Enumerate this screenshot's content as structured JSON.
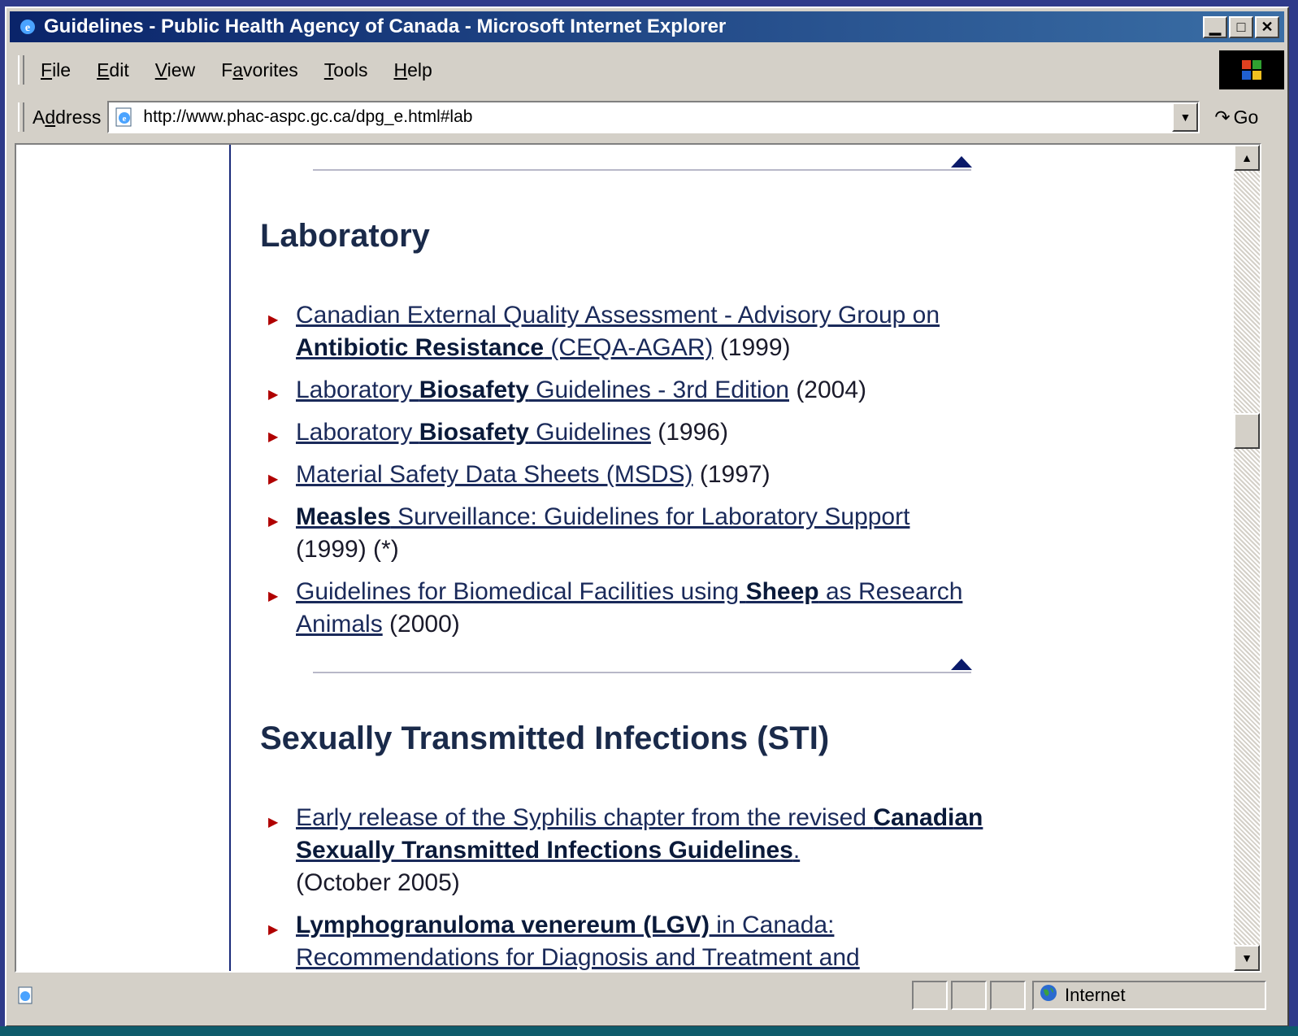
{
  "window": {
    "title": "Guidelines - Public Health Agency of Canada - Microsoft Internet Explorer",
    "min_glyph": "▁",
    "max_glyph": "□",
    "close_glyph": "✕"
  },
  "menu": {
    "items": [
      {
        "accel": "F",
        "rest": "ile"
      },
      {
        "accel": "E",
        "rest": "dit"
      },
      {
        "accel": "V",
        "rest": "iew"
      },
      {
        "pre": "F",
        "accel": "a",
        "rest": "vorites"
      },
      {
        "accel": "T",
        "rest": "ools"
      },
      {
        "accel": "H",
        "rest": "elp"
      }
    ]
  },
  "address": {
    "label_pre": "A",
    "label_accel": "d",
    "label_rest": "dress",
    "url": "http://www.phac-aspc.gc.ca/dpg_e.html#lab",
    "go_label": "Go"
  },
  "sections": {
    "laboratory": {
      "heading": "Laboratory",
      "items": [
        {
          "parts": [
            "Canadian External Quality Assessment - Advisory Group on ",
            "Antibiotic Resistance",
            " (CEQA-AGAR)"
          ],
          "suffix": " (1999)"
        },
        {
          "parts": [
            "Laboratory ",
            "Biosafety",
            " Guidelines - 3rd Edition"
          ],
          "suffix": " (2004)"
        },
        {
          "parts": [
            "Laboratory ",
            "Biosafety",
            " Guidelines"
          ],
          "suffix": " (1996)"
        },
        {
          "parts": [
            "Material Safety Data Sheets (MSDS)",
            "",
            ""
          ],
          "suffix": " (1997)"
        },
        {
          "parts": [
            "",
            "Measles",
            " Surveillance: Guidelines for Laboratory Support"
          ],
          "suffix": " (1999) (*)"
        },
        {
          "parts": [
            "Guidelines for Biomedical Facilities using ",
            "Sheep",
            " as Research Animals"
          ],
          "suffix": " (2000)"
        }
      ]
    },
    "sti": {
      "heading": "Sexually Transmitted Infections (STI)",
      "items": [
        {
          "parts": [
            "Early release of the Syphilis chapter from the revised ",
            "Canadian Sexually Transmitted Infections Guidelines",
            "."
          ],
          "suffix": " (October 2005)"
        },
        {
          "parts": [
            "",
            "Lymphogranuloma venereum (LGV)",
            " in Canada: Recommendations for Diagnosis and Treatment and"
          ],
          "suffix": ""
        }
      ]
    }
  },
  "status": {
    "zone": "Internet"
  },
  "colors": {
    "titlebar_start": "#0a246a",
    "link": "#1a2a5a",
    "heading": "#1a2a4a",
    "bullet": "#b00000"
  }
}
